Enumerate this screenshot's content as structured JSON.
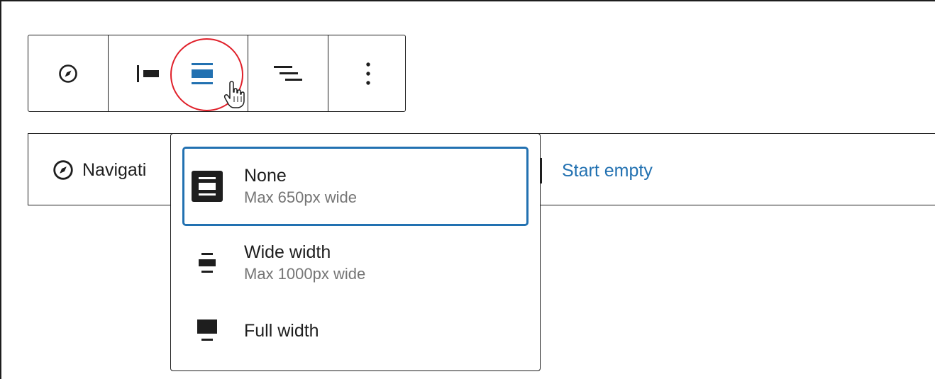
{
  "toolbar": {
    "buttons": [
      {
        "icon": "navigation-compass-icon",
        "label": ""
      },
      {
        "icon": "align-left-icon",
        "label": ""
      },
      {
        "icon": "align-center-icon",
        "label": ""
      },
      {
        "icon": "justify-right-icon",
        "label": ""
      },
      {
        "icon": "more-vertical-icon",
        "label": ""
      }
    ]
  },
  "nav_block": {
    "label": "Navigati",
    "start_empty": "Start empty"
  },
  "dropdown": {
    "items": [
      {
        "title": "None",
        "subtitle": "Max 650px wide",
        "icon": "none-width-icon",
        "selected": true
      },
      {
        "title": "Wide width",
        "subtitle": "Max 1000px wide",
        "icon": "wide-width-icon",
        "selected": false
      },
      {
        "title": "Full width",
        "subtitle": "",
        "icon": "full-width-icon",
        "selected": false
      }
    ]
  },
  "colors": {
    "accent": "#2271b1",
    "highlight_ring": "#e0202a",
    "text": "#1e1e1e",
    "muted": "#757575"
  }
}
